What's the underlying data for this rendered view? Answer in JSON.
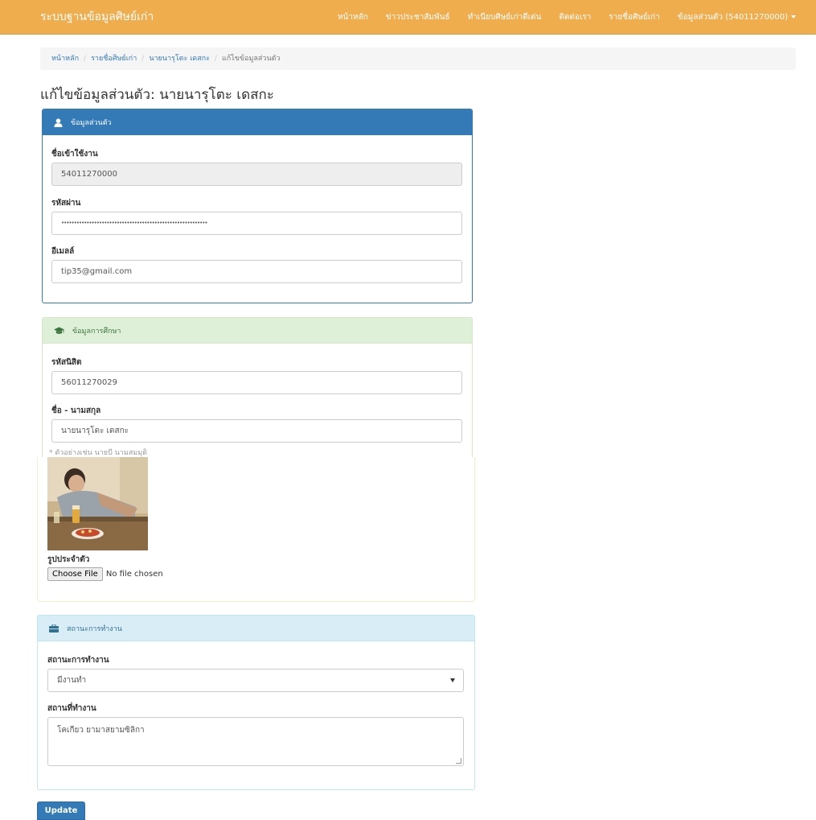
{
  "navbar": {
    "brand": "ระบบฐานข้อมูลศิษย์เก่า",
    "links": [
      "หน้าหลัก",
      "ข่าวประชาสัมพันธ์",
      "ทำเนียบศิษย์เก่าดีเด่น",
      "ติดต่อเรา",
      "รายชื่อศิษย์เก่า",
      "ข้อมูลส่วนตัว (54011270000)"
    ]
  },
  "breadcrumb": [
    "หน้าหลัก",
    "รายชื่อศิษย์เก่า",
    "นายนารุโตะ เดสกะ",
    "แก้ไขข้อมูลส่วนตัว"
  ],
  "page_title": "แก้ไขข้อมูลส่วนตัว: นายนารุโตะ เดสกะ",
  "personal": {
    "heading": "ข้อมูลส่วนตัว",
    "username_label": "ชื่อเข้าใช้งาน",
    "username_value": "54011270000",
    "password_label": "รหัสผ่าน",
    "password_value": "••••••••••••••••••••••••••••••••••••••••••••••••••••••••••",
    "email_label": "อีเมลล์",
    "email_value": "tip35@gmail.com"
  },
  "education": {
    "heading": "ข้อมูลการศึกษา",
    "student_id_label": "รหัสนิสิต",
    "student_id_value": "56011270029",
    "fullname_label": "ชื่อ - นามสกุล",
    "fullname_value": "นายนารุโตะ เดสกะ",
    "fullname_help": "* ตัวอย่างเช่น นายบี นามสมมุติ",
    "photo_label": "รูปประจำตัว",
    "file_button": "Choose File",
    "file_status": "No file chosen"
  },
  "work": {
    "heading": "สถานะการทำงาน",
    "status_label": "สถานะการทำงาน",
    "status_value": "มีงานทำ",
    "place_label": "สถานที่ทำงาน",
    "place_value": "โคเกียว ยามาสยามซิลิกา"
  },
  "submit_label": "Update",
  "colors": {
    "navbar": "#f0ad4e",
    "primary": "#337ab7",
    "success_bg": "#dff0d8",
    "info_bg": "#d9edf7"
  }
}
